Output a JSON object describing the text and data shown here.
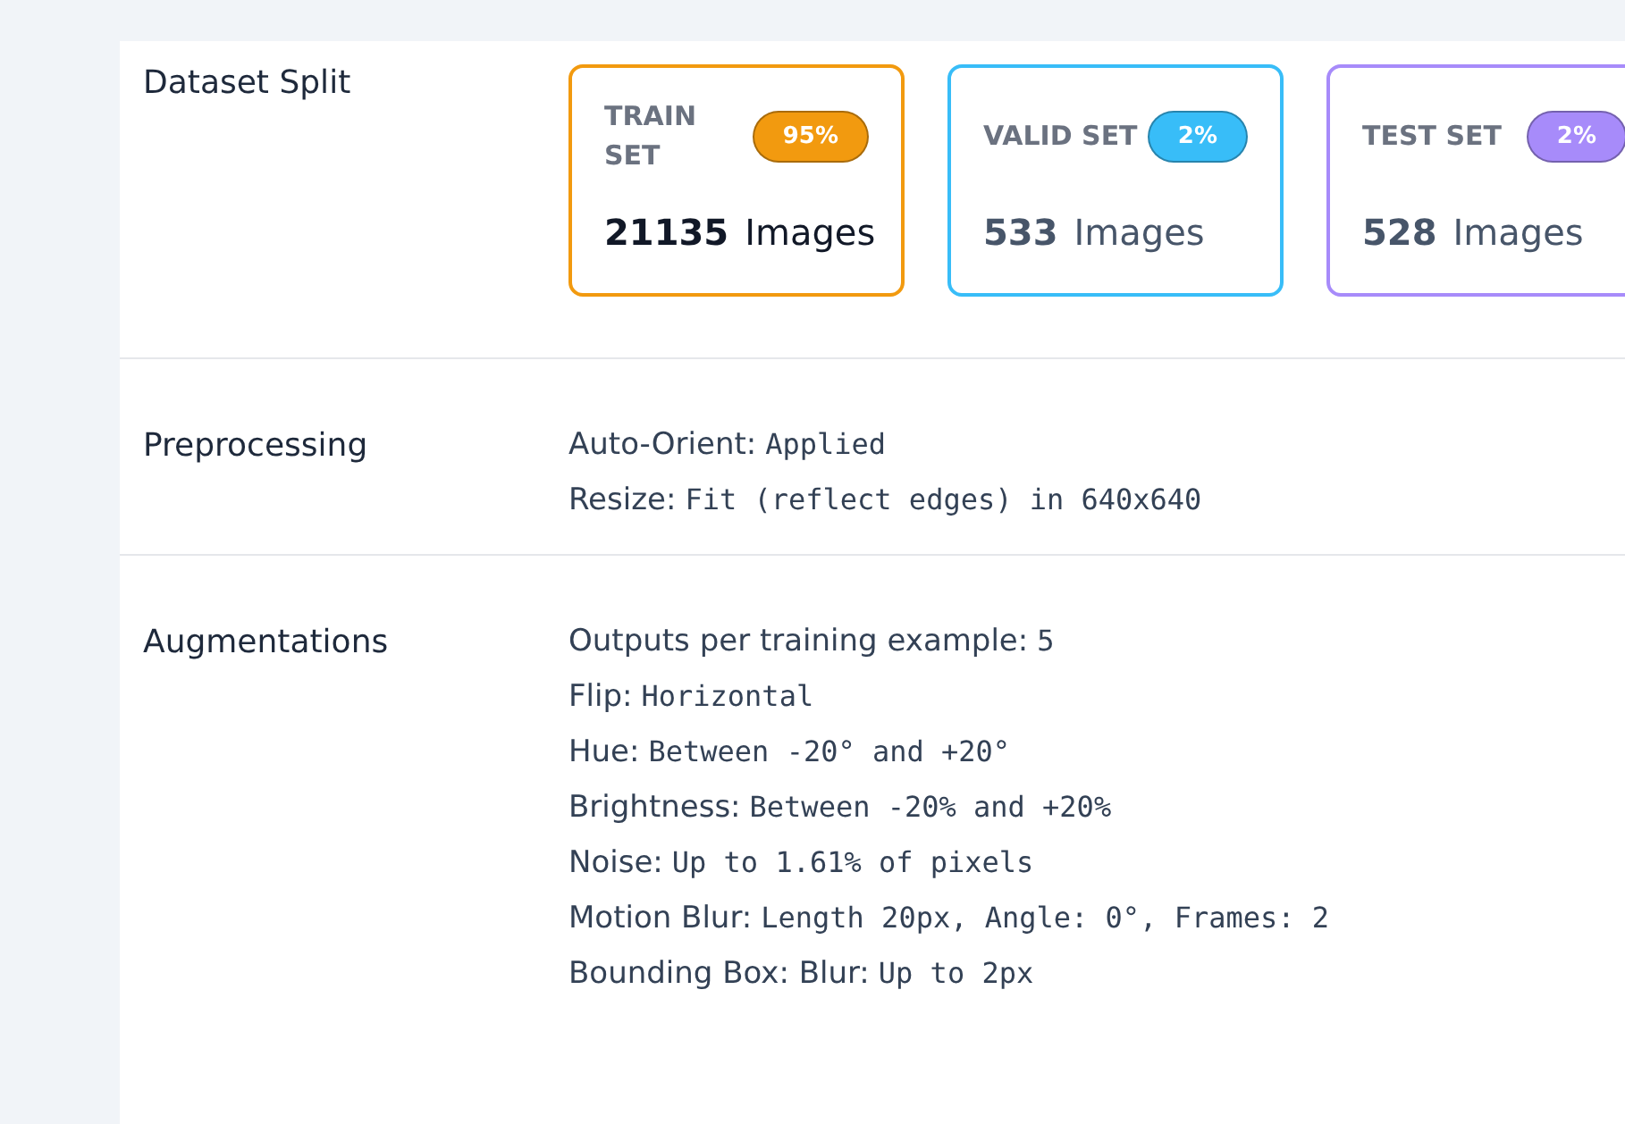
{
  "sections": [
    {
      "kind": "split",
      "title": "Dataset Split",
      "cards": [
        {
          "label": "TRAIN SET",
          "percent": "95%",
          "count": "21135",
          "unit": "Images",
          "color": "#f29a0f"
        },
        {
          "label": "VALID SET",
          "percent": "2%",
          "count": "533",
          "unit": "Images",
          "color": "#38bdf8"
        },
        {
          "label": "TEST SET",
          "percent": "2%",
          "count": "528",
          "unit": "Images",
          "color": "#a78bfa"
        }
      ]
    },
    {
      "kind": "list",
      "title": "Preprocessing",
      "items": [
        {
          "label": "Auto-Orient:",
          "value": "Applied"
        },
        {
          "label": "Resize:",
          "value": "Fit (reflect edges) in 640x640"
        }
      ]
    },
    {
      "kind": "list",
      "title": "Augmentations",
      "items": [
        {
          "label": "Outputs per training example:",
          "value": "5"
        },
        {
          "label": "Flip:",
          "value": "Horizontal"
        },
        {
          "label": "Hue:",
          "value": "Between -20° and +20°"
        },
        {
          "label": "Brightness:",
          "value": "Between -20% and +20%"
        },
        {
          "label": "Noise:",
          "value": "Up to 1.61% of pixels"
        },
        {
          "label": "Motion Blur:",
          "value": "Length 20px, Angle: 0°, Frames: 2"
        },
        {
          "label": "Bounding Box: Blur:",
          "value": "Up to 2px"
        }
      ]
    }
  ]
}
